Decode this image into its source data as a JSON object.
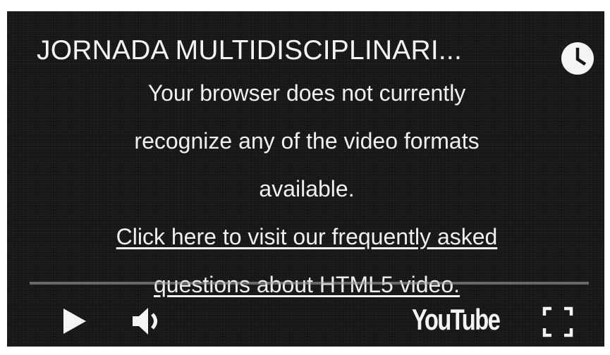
{
  "player": {
    "title": "JORNADA MULTIDISCIPLINARI...",
    "message_lines": [
      "Your browser does not currently",
      "recognize any of the video formats",
      "available."
    ],
    "faq_link_lines": [
      "Click here to visit our frequently asked",
      "questions about HTML5 video."
    ],
    "brand": "YouTube"
  },
  "icons": {
    "clock": "clock-icon",
    "play": "play-icon",
    "volume": "volume-icon",
    "fullscreen": "fullscreen-icon"
  },
  "colors": {
    "background": "#151515",
    "text": "#f2f2f2"
  }
}
